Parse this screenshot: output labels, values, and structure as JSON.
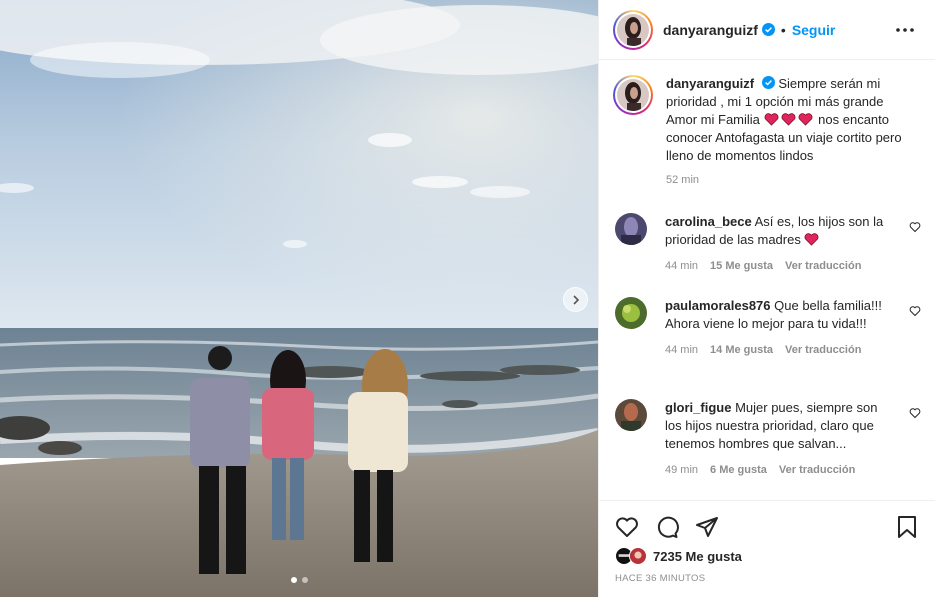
{
  "post": {
    "username": "danyaranguizf",
    "follow_label": "Seguir",
    "separator": "•",
    "more_icon": "more-horizontal-icon",
    "carousel": {
      "slide_count": 2,
      "active_slide": 1
    },
    "caption": {
      "text_1": "Siempre serán mi prioridad , mi 1 opción mi más grande Amor mi Familia",
      "text_2": "nos encanto conocer Antofagasta un viaje cortito pero lleno de momentos lindos",
      "time": "52 min"
    },
    "comments": [
      {
        "username": "carolina_bece",
        "text": "Así es, los hijos son la prioridad de las madres",
        "has_heart_emoji": true,
        "time": "44 min",
        "likes": "15 Me gusta",
        "translate": "Ver traducción"
      },
      {
        "username": "paulamorales876",
        "text": "Que bella familia!!! Ahora viene lo mejor para tu vida!!!",
        "time": "44 min",
        "likes": "14 Me gusta",
        "translate": "Ver traducción"
      },
      {
        "username": "glori_figue",
        "text": "Mujer pues, siempre son los hijos nuestra prioridad, claro que tenemos hombres que salvan...",
        "time": "49 min",
        "likes": "6 Me gusta",
        "translate": "Ver traducción"
      }
    ],
    "likes_label": "7235 Me gusta",
    "date": "HACE 36 MINUTOS",
    "colors": {
      "accent": "#0095f6",
      "heart_red": "#e0245e",
      "text": "#262626",
      "muted": "#8e8e8e"
    }
  }
}
